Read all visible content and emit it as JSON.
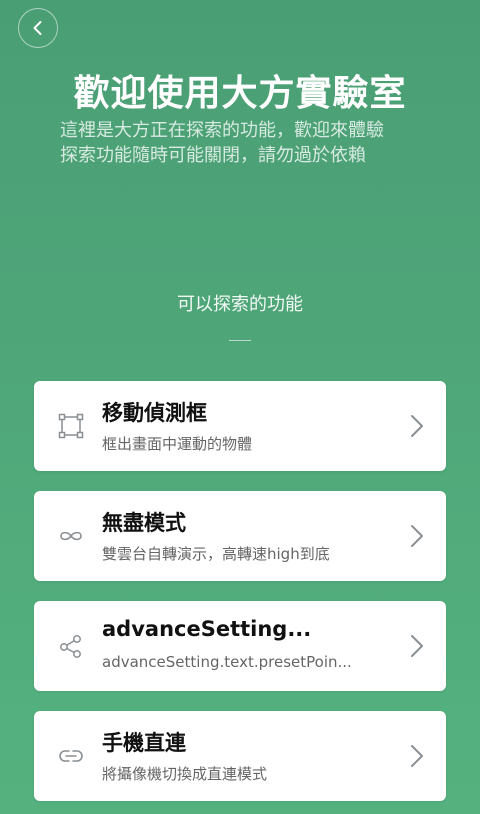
{
  "header": {
    "title": "歡迎使用大方實驗室",
    "subtitle_lines": [
      "這裡是大方正在探索的功能，歡迎來體驗",
      "探索功能隨時可能關閉，請勿過於依賴"
    ]
  },
  "section": {
    "title": "可以探索的功能"
  },
  "features": [
    {
      "icon": "bounding-box-icon",
      "name": "移動偵測框",
      "desc": "框出畫面中運動的物體"
    },
    {
      "icon": "infinity-icon",
      "name": "無盡模式",
      "desc": "雙雲台自轉演示，高轉速high到底"
    },
    {
      "icon": "share-nodes-icon",
      "name": "advanceSetting...",
      "desc": "advanceSetting.text.presetPoin..."
    },
    {
      "icon": "link-icon",
      "name": "手機直連",
      "desc": "將攝像機切換成直連模式"
    }
  ],
  "colors": {
    "background_top": "#4a9e74",
    "background_bottom": "#55b27f",
    "card": "#ffffff",
    "icon": "#8a8f94"
  }
}
